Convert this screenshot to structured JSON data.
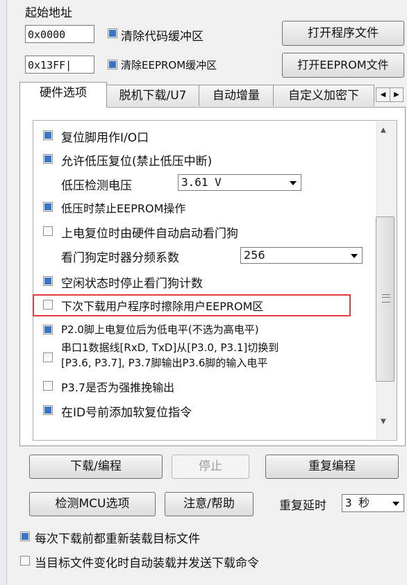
{
  "address": {
    "title": "起始地址",
    "start_value": "0x0000",
    "end_value": "0x13FF|",
    "clear_code_label": "清除代码缓冲区",
    "clear_eeprom_label": "清除EEPROM缓冲区",
    "clear_code_checked": true,
    "clear_eeprom_checked": true
  },
  "buttons": {
    "open_program": "打开程序文件",
    "open_eeprom": "打开EEPROM文件",
    "download": "下载/编程",
    "stop": "停止",
    "repeat": "重复编程",
    "check_mcu": "检测MCU选项",
    "help": "注意/帮助"
  },
  "tabs": [
    "硬件选项",
    "脱机下载/U7",
    "自动增量",
    "自定义加密下"
  ],
  "options": [
    {
      "label": "复位脚用作I/O口",
      "checked": true
    },
    {
      "label": "允许低压复位(禁止低压中断)",
      "checked": true
    },
    {
      "label": "低压时禁止EEPROM操作",
      "checked": true
    },
    {
      "label": "上电复位时由硬件自动启动看门狗",
      "checked": false
    },
    {
      "label": "空闲状态时停止看门狗计数",
      "checked": true
    },
    {
      "label": "下次下载用户程序时擦除用户EEPROM区",
      "checked": false
    },
    {
      "label": "P2.0脚上电复位后为低电平(不选为高电平)",
      "checked": true
    },
    {
      "label_line1": "串口1数据线[RxD, TxD]从[P3.0, P3.1]切换到",
      "label_line2": "[P3.6, P3.7], P3.7脚输出P3.6脚的输入电平",
      "checked": false
    },
    {
      "label": "P3.7是否为强推挽输出",
      "checked": false
    },
    {
      "label": "在ID号前添加软复位指令",
      "checked": true
    }
  ],
  "low_voltage": {
    "label": "低压检测电压",
    "value": "3.61 V"
  },
  "watchdog": {
    "label": "看门狗定时器分频系数",
    "value": "256"
  },
  "repeat_delay": {
    "label": "重复延时",
    "value": "3 秒"
  },
  "bottom": {
    "reload_label": "每次下载前都重新装载目标文件",
    "reload_checked": true,
    "auto_label": "当目标文件变化时自动装载并发送下载命令",
    "auto_checked": false
  }
}
